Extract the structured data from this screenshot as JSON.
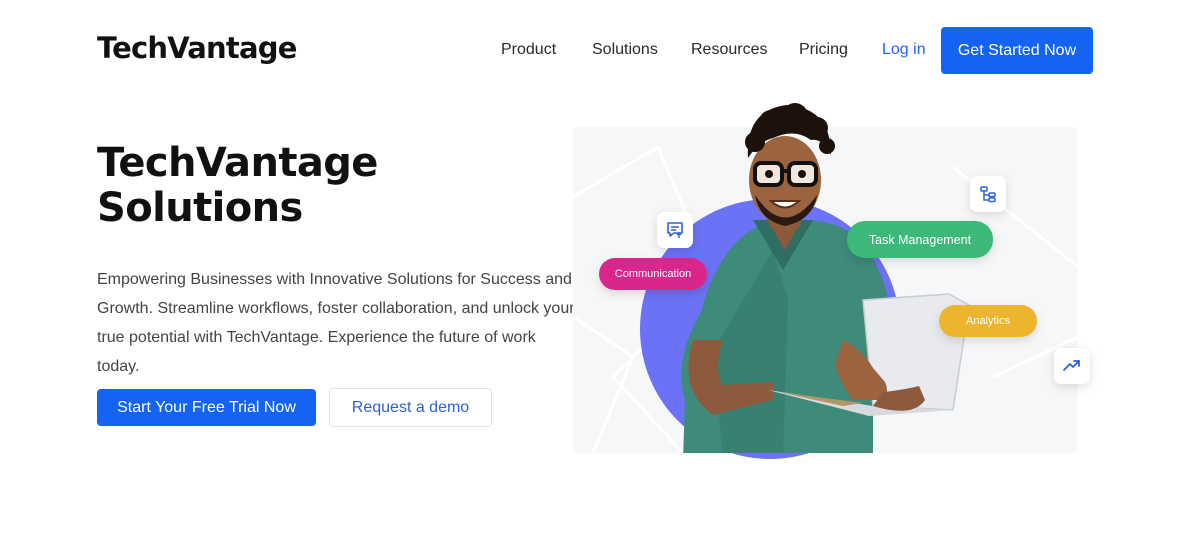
{
  "header": {
    "logo": "TechVantage",
    "nav": [
      "Product",
      "Solutions",
      "Resources",
      "Pricing"
    ],
    "login": "Log in",
    "cta": "Get Started Now"
  },
  "hero": {
    "title_line1": "TechVantage",
    "title_line2": "Solutions",
    "description": "Empowering Businesses with Innovative Solutions for Success and Growth. Streamline workflows, foster collaboration, and unlock your true potential with TechVantage. Experience the future of work today.",
    "primary_button": "Start Your Free Trial Now",
    "secondary_button": "Request a demo"
  },
  "illustration": {
    "tags": {
      "communication": "Communication",
      "task_management": "Task Management",
      "analytics": "Analytics"
    },
    "icons": [
      "chat-icon",
      "hierarchy-icon",
      "trending-up-icon"
    ]
  },
  "colors": {
    "primary": "#1463f3",
    "circle": "#6b72f5",
    "communication": "#d9268c",
    "task_management": "#3cb878",
    "analytics": "#edb52e",
    "shirt": "#3e8a7b"
  }
}
